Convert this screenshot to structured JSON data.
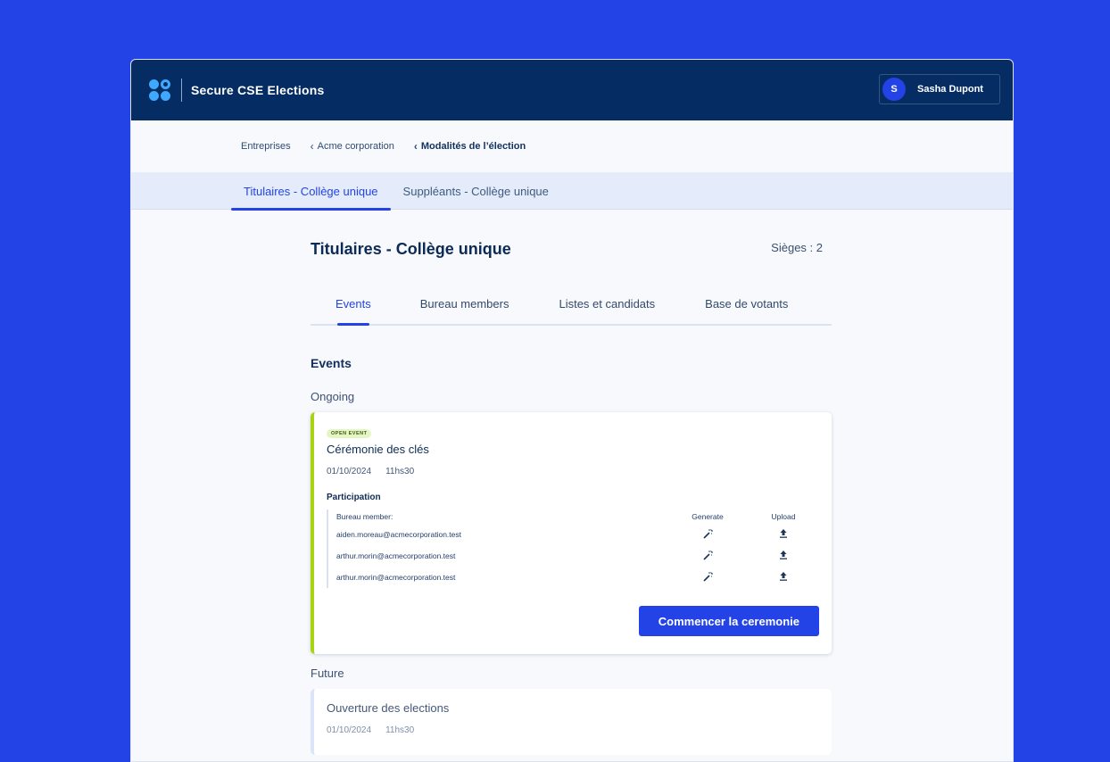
{
  "app": {
    "title": "Secure CSE Elections"
  },
  "user": {
    "initial": "S",
    "name": "Sasha Dupont"
  },
  "breadcrumb": [
    {
      "label": "Entreprises"
    },
    {
      "label": "Acme corporation"
    },
    {
      "label": "Modalités de l’élection"
    }
  ],
  "top_tabs": [
    {
      "label": "Titulaires - Collège unique"
    },
    {
      "label": "Suppléants - Collège unique"
    }
  ],
  "section": {
    "title": "Titulaires - Collège unique",
    "seats": "Sièges : 2"
  },
  "inner_tabs": [
    {
      "label": "Events"
    },
    {
      "label": "Bureau members"
    },
    {
      "label": "Listes et candidats"
    },
    {
      "label": "Base de votants"
    }
  ],
  "events": {
    "heading": "Events",
    "ongoing_label": "Ongoing",
    "future_label": "Future",
    "ongoing": {
      "badge": "OPEN EVENT",
      "title": "Cérémonie des clés",
      "date": "01/10/2024",
      "time": "11hs30",
      "participation_title": "Participation",
      "columns": {
        "member": "Bureau member:",
        "generate": "Generate",
        "upload": "Upload"
      },
      "rows": [
        {
          "email": "aiden.moreau@acmecorporation.test"
        },
        {
          "email": "arthur.morin@acmecorporation.test"
        },
        {
          "email": "arthur.morin@acmecorporation.test"
        }
      ],
      "action_label": "Commencer la ceremonie"
    },
    "future": {
      "title": "Ouverture des elections",
      "date": "01/10/2024",
      "time": "11hs30"
    }
  },
  "icons": {
    "generate": "magic-wand-icon",
    "upload": "upload-icon",
    "breadcrumb_sep": "chevron-left-icon"
  },
  "colors": {
    "brand": "#2343e6",
    "navbar": "#052c63",
    "ongoing_accent": "#a8d310"
  }
}
